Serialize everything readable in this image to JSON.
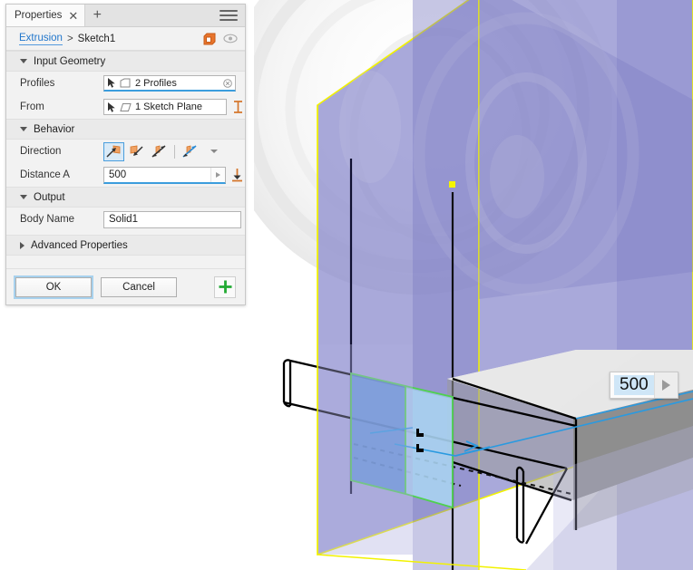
{
  "tabbar": {
    "tab_label": "Properties",
    "close_icon": "close-icon",
    "add_icon": "plus-icon",
    "menu_icon": "hamburger-menu-icon"
  },
  "breadcrumb": {
    "link": "Extrusion",
    "separator": ">",
    "current": "Sketch1",
    "cube_icon": "orange-cube-icon",
    "eye_icon": "visibility-eye-icon"
  },
  "sections": {
    "input_geometry": {
      "title": "Input Geometry",
      "expanded": true,
      "rows": [
        {
          "label": "Profiles",
          "value": "2 Profiles",
          "cursor_icon": "select-arrow-icon",
          "type_icon": "profile-face-icon",
          "clear_icon": "clear-selection-icon"
        },
        {
          "label": "From",
          "value": "1 Sketch Plane",
          "cursor_icon": "select-arrow-icon",
          "type_icon": "sketch-plane-icon",
          "tool_icon": "offset-measure-icon"
        }
      ]
    },
    "behavior": {
      "title": "Behavior",
      "expanded": true,
      "direction": {
        "label": "Direction",
        "options": [
          "one-side",
          "flip-side",
          "symmetric",
          "two-sides"
        ],
        "selected_index": 0,
        "dropdown_icon": "chevron-down-icon"
      },
      "distance": {
        "label": "Distance A",
        "value": "500",
        "spin_icon": "expand-arrow-icon",
        "tool_icon": "taper-angle-icon"
      }
    },
    "output": {
      "title": "Output",
      "expanded": true,
      "body_name": {
        "label": "Body Name",
        "value": "Solid1"
      }
    },
    "advanced": {
      "title": "Advanced Properties",
      "expanded": false
    }
  },
  "footer": {
    "ok_label": "OK",
    "cancel_label": "Cancel",
    "add_icon": "add-green-plus-icon"
  },
  "viewport": {
    "dimension_box": {
      "value": "500",
      "spin_icon": "expand-arrow-icon"
    },
    "colors": {
      "plane_purple": "#8a8ac8",
      "plane_outline_yellow": "#f2f200",
      "profile_blue_dark": "#5b92d8",
      "profile_blue_light": "#a8d2ef",
      "profile_outline_green": "#4fd14f",
      "body_gray": "#8c8c8c",
      "body_gray_light": "#e2e2e2",
      "sketch_black": "#000000",
      "dimension_blue": "#2a9ae0",
      "origin_point_yellow": "#f5f500"
    }
  }
}
